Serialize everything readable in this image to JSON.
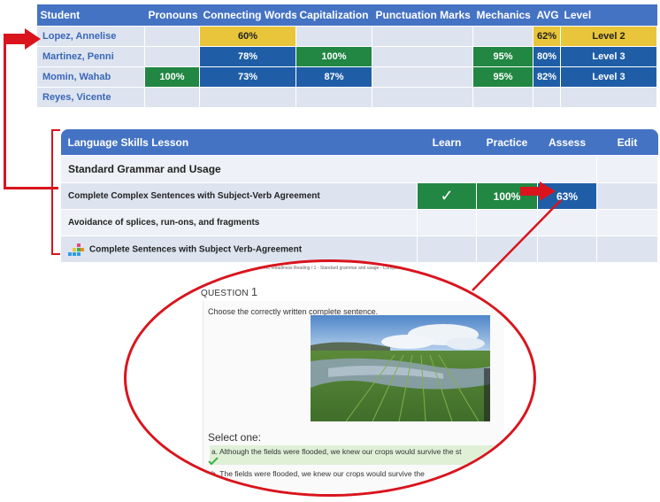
{
  "gradebook": {
    "headers": [
      "Student",
      "Pronouns",
      "Connecting Words",
      "Capitalization",
      "Punctuation Marks",
      "Mechanics",
      "AVG",
      "Level"
    ],
    "rows": [
      {
        "name": "Lopez, Annelise",
        "cells": [
          "",
          "60%",
          "",
          "",
          "",
          "62%",
          "Level 2"
        ],
        "colors": [
          "",
          "yellow",
          "",
          "",
          "",
          "yellow",
          "yellow"
        ]
      },
      {
        "name": "Martinez, Penni",
        "cells": [
          "",
          "78%",
          "100%",
          "",
          "95%",
          "80%",
          "Level 3"
        ],
        "colors": [
          "",
          "blue",
          "green",
          "",
          "green",
          "blue",
          "blue"
        ]
      },
      {
        "name": "Momin, Wahab",
        "cells": [
          "100%",
          "73%",
          "87%",
          "",
          "95%",
          "82%",
          "Level 3"
        ],
        "colors": [
          "green",
          "blue",
          "blue",
          "",
          "green",
          "blue",
          "blue"
        ]
      },
      {
        "name": "Reyes, Vicente",
        "cells": [
          "",
          "",
          "",
          "",
          "",
          "",
          ""
        ],
        "colors": [
          "",
          "",
          "",
          "",
          "",
          "",
          ""
        ]
      }
    ]
  },
  "lesson": {
    "headers": [
      "Language Skills Lesson",
      "Learn",
      "Practice",
      "Assess",
      "Edit"
    ],
    "section_title": "Standard Grammar and Usage",
    "rows": [
      {
        "label": "Complete Complex Sentences with Subject-Verb Agreement",
        "learn": "✓",
        "practice": "100%",
        "assess": "63%"
      },
      {
        "label": "Avoidance of splices, run-ons, and fragments",
        "learn": "",
        "practice": "",
        "assess": ""
      },
      {
        "label": "Complete Sentences with Subject Verb-Agreement",
        "learn": "",
        "practice": "",
        "assess": ""
      }
    ]
  },
  "quiz": {
    "breadcrumb": "... > GROUP 2 / ELPAC Readiness Reading / 1 - Standard grammar and usage - Complete ...",
    "question_label": "QUESTION",
    "question_number": "1",
    "question_text": "Choose the correctly written complete sentence.",
    "photo_caption": "Stock Photo / Image",
    "select_label": "Select one:",
    "option_a": "a.  Although the fields were flooded, we knew our crops would survive the st",
    "option_b": "b.  The fields were flooded, we knew our crops would survive the"
  },
  "colors": {
    "header_blue": "#4573c4",
    "yellow": "#e8c53a",
    "blue": "#1f5ea6",
    "green": "#218742",
    "red": "#d9141d",
    "row_bg": "#dde4f0"
  },
  "icons": [
    "arrow-right-icon",
    "checkmark-icon",
    "squares-activity-icon"
  ]
}
